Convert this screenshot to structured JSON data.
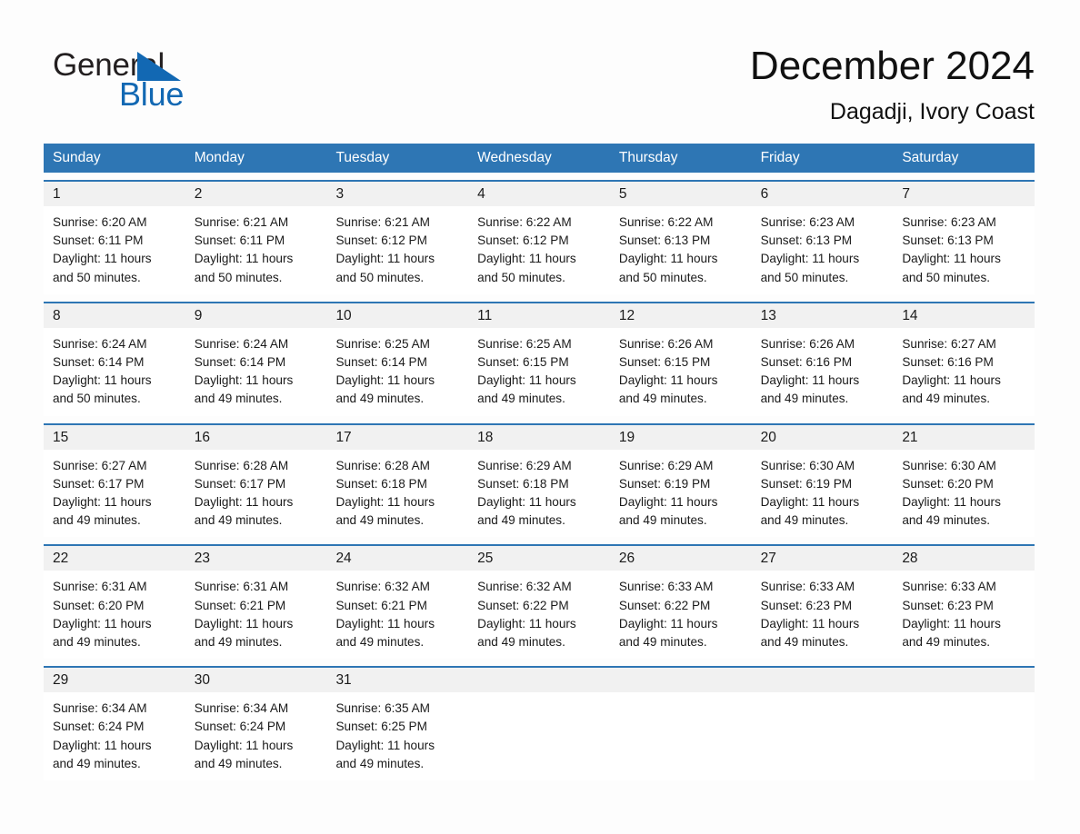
{
  "brand": {
    "name_part1": "General",
    "name_part2": "Blue",
    "triangle_color": "#1268b3",
    "accent_color": "#2e76b4"
  },
  "header": {
    "title": "December 2024",
    "subtitle": "Dagadji, Ivory Coast"
  },
  "calendar": {
    "weekday_headers": [
      "Sunday",
      "Monday",
      "Tuesday",
      "Wednesday",
      "Thursday",
      "Friday",
      "Saturday"
    ],
    "weeks": [
      {
        "daynums": [
          "1",
          "2",
          "3",
          "4",
          "5",
          "6",
          "7"
        ],
        "cells": [
          {
            "sunrise": "Sunrise: 6:20 AM",
            "sunset": "Sunset: 6:11 PM",
            "daylight_1": "Daylight: 11 hours",
            "daylight_2": "and 50 minutes."
          },
          {
            "sunrise": "Sunrise: 6:21 AM",
            "sunset": "Sunset: 6:11 PM",
            "daylight_1": "Daylight: 11 hours",
            "daylight_2": "and 50 minutes."
          },
          {
            "sunrise": "Sunrise: 6:21 AM",
            "sunset": "Sunset: 6:12 PM",
            "daylight_1": "Daylight: 11 hours",
            "daylight_2": "and 50 minutes."
          },
          {
            "sunrise": "Sunrise: 6:22 AM",
            "sunset": "Sunset: 6:12 PM",
            "daylight_1": "Daylight: 11 hours",
            "daylight_2": "and 50 minutes."
          },
          {
            "sunrise": "Sunrise: 6:22 AM",
            "sunset": "Sunset: 6:13 PM",
            "daylight_1": "Daylight: 11 hours",
            "daylight_2": "and 50 minutes."
          },
          {
            "sunrise": "Sunrise: 6:23 AM",
            "sunset": "Sunset: 6:13 PM",
            "daylight_1": "Daylight: 11 hours",
            "daylight_2": "and 50 minutes."
          },
          {
            "sunrise": "Sunrise: 6:23 AM",
            "sunset": "Sunset: 6:13 PM",
            "daylight_1": "Daylight: 11 hours",
            "daylight_2": "and 50 minutes."
          }
        ]
      },
      {
        "daynums": [
          "8",
          "9",
          "10",
          "11",
          "12",
          "13",
          "14"
        ],
        "cells": [
          {
            "sunrise": "Sunrise: 6:24 AM",
            "sunset": "Sunset: 6:14 PM",
            "daylight_1": "Daylight: 11 hours",
            "daylight_2": "and 50 minutes."
          },
          {
            "sunrise": "Sunrise: 6:24 AM",
            "sunset": "Sunset: 6:14 PM",
            "daylight_1": "Daylight: 11 hours",
            "daylight_2": "and 49 minutes."
          },
          {
            "sunrise": "Sunrise: 6:25 AM",
            "sunset": "Sunset: 6:14 PM",
            "daylight_1": "Daylight: 11 hours",
            "daylight_2": "and 49 minutes."
          },
          {
            "sunrise": "Sunrise: 6:25 AM",
            "sunset": "Sunset: 6:15 PM",
            "daylight_1": "Daylight: 11 hours",
            "daylight_2": "and 49 minutes."
          },
          {
            "sunrise": "Sunrise: 6:26 AM",
            "sunset": "Sunset: 6:15 PM",
            "daylight_1": "Daylight: 11 hours",
            "daylight_2": "and 49 minutes."
          },
          {
            "sunrise": "Sunrise: 6:26 AM",
            "sunset": "Sunset: 6:16 PM",
            "daylight_1": "Daylight: 11 hours",
            "daylight_2": "and 49 minutes."
          },
          {
            "sunrise": "Sunrise: 6:27 AM",
            "sunset": "Sunset: 6:16 PM",
            "daylight_1": "Daylight: 11 hours",
            "daylight_2": "and 49 minutes."
          }
        ]
      },
      {
        "daynums": [
          "15",
          "16",
          "17",
          "18",
          "19",
          "20",
          "21"
        ],
        "cells": [
          {
            "sunrise": "Sunrise: 6:27 AM",
            "sunset": "Sunset: 6:17 PM",
            "daylight_1": "Daylight: 11 hours",
            "daylight_2": "and 49 minutes."
          },
          {
            "sunrise": "Sunrise: 6:28 AM",
            "sunset": "Sunset: 6:17 PM",
            "daylight_1": "Daylight: 11 hours",
            "daylight_2": "and 49 minutes."
          },
          {
            "sunrise": "Sunrise: 6:28 AM",
            "sunset": "Sunset: 6:18 PM",
            "daylight_1": "Daylight: 11 hours",
            "daylight_2": "and 49 minutes."
          },
          {
            "sunrise": "Sunrise: 6:29 AM",
            "sunset": "Sunset: 6:18 PM",
            "daylight_1": "Daylight: 11 hours",
            "daylight_2": "and 49 minutes."
          },
          {
            "sunrise": "Sunrise: 6:29 AM",
            "sunset": "Sunset: 6:19 PM",
            "daylight_1": "Daylight: 11 hours",
            "daylight_2": "and 49 minutes."
          },
          {
            "sunrise": "Sunrise: 6:30 AM",
            "sunset": "Sunset: 6:19 PM",
            "daylight_1": "Daylight: 11 hours",
            "daylight_2": "and 49 minutes."
          },
          {
            "sunrise": "Sunrise: 6:30 AM",
            "sunset": "Sunset: 6:20 PM",
            "daylight_1": "Daylight: 11 hours",
            "daylight_2": "and 49 minutes."
          }
        ]
      },
      {
        "daynums": [
          "22",
          "23",
          "24",
          "25",
          "26",
          "27",
          "28"
        ],
        "cells": [
          {
            "sunrise": "Sunrise: 6:31 AM",
            "sunset": "Sunset: 6:20 PM",
            "daylight_1": "Daylight: 11 hours",
            "daylight_2": "and 49 minutes."
          },
          {
            "sunrise": "Sunrise: 6:31 AM",
            "sunset": "Sunset: 6:21 PM",
            "daylight_1": "Daylight: 11 hours",
            "daylight_2": "and 49 minutes."
          },
          {
            "sunrise": "Sunrise: 6:32 AM",
            "sunset": "Sunset: 6:21 PM",
            "daylight_1": "Daylight: 11 hours",
            "daylight_2": "and 49 minutes."
          },
          {
            "sunrise": "Sunrise: 6:32 AM",
            "sunset": "Sunset: 6:22 PM",
            "daylight_1": "Daylight: 11 hours",
            "daylight_2": "and 49 minutes."
          },
          {
            "sunrise": "Sunrise: 6:33 AM",
            "sunset": "Sunset: 6:22 PM",
            "daylight_1": "Daylight: 11 hours",
            "daylight_2": "and 49 minutes."
          },
          {
            "sunrise": "Sunrise: 6:33 AM",
            "sunset": "Sunset: 6:23 PM",
            "daylight_1": "Daylight: 11 hours",
            "daylight_2": "and 49 minutes."
          },
          {
            "sunrise": "Sunrise: 6:33 AM",
            "sunset": "Sunset: 6:23 PM",
            "daylight_1": "Daylight: 11 hours",
            "daylight_2": "and 49 minutes."
          }
        ]
      },
      {
        "daynums": [
          "29",
          "30",
          "31",
          "",
          "",
          "",
          ""
        ],
        "cells": [
          {
            "sunrise": "Sunrise: 6:34 AM",
            "sunset": "Sunset: 6:24 PM",
            "daylight_1": "Daylight: 11 hours",
            "daylight_2": "and 49 minutes."
          },
          {
            "sunrise": "Sunrise: 6:34 AM",
            "sunset": "Sunset: 6:24 PM",
            "daylight_1": "Daylight: 11 hours",
            "daylight_2": "and 49 minutes."
          },
          {
            "sunrise": "Sunrise: 6:35 AM",
            "sunset": "Sunset: 6:25 PM",
            "daylight_1": "Daylight: 11 hours",
            "daylight_2": "and 49 minutes."
          },
          {
            "sunrise": "",
            "sunset": "",
            "daylight_1": "",
            "daylight_2": ""
          },
          {
            "sunrise": "",
            "sunset": "",
            "daylight_1": "",
            "daylight_2": ""
          },
          {
            "sunrise": "",
            "sunset": "",
            "daylight_1": "",
            "daylight_2": ""
          },
          {
            "sunrise": "",
            "sunset": "",
            "daylight_1": "",
            "daylight_2": ""
          }
        ]
      }
    ]
  }
}
